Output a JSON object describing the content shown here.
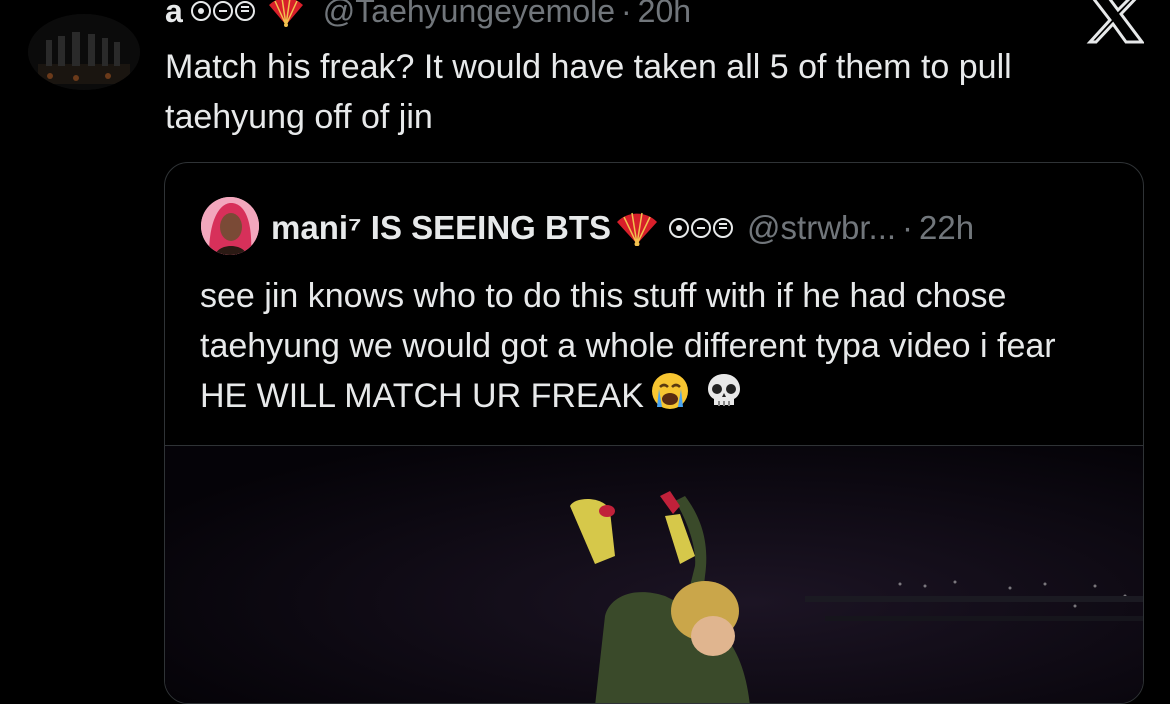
{
  "tweet": {
    "author_name": "a",
    "handle": "@Taehyungeyemole",
    "separator": "·",
    "time": "20h",
    "text": "Match his freak? It would have taken all 5 of them to pull taehyung off of jin"
  },
  "quote": {
    "author_name": "mani⁷ IS SEEING BTS",
    "handle": "@strwbr...",
    "separator": "·",
    "time": "22h",
    "text": "see jin knows who to do this stuff with if he had chose taehyung we would got a whole different typa video i fear HE WILL MATCH UR FREAK",
    "emojis": [
      "crying-face-icon",
      "skull-icon"
    ]
  },
  "icons": [
    "x-logo-icon",
    "fan-icon",
    "circle-dot-icon",
    "circle-minus-icon",
    "circle-equals-icon"
  ],
  "colors": {
    "background": "#000000",
    "text": "#e7e9ea",
    "muted": "#71767b",
    "border": "#2f3336"
  }
}
